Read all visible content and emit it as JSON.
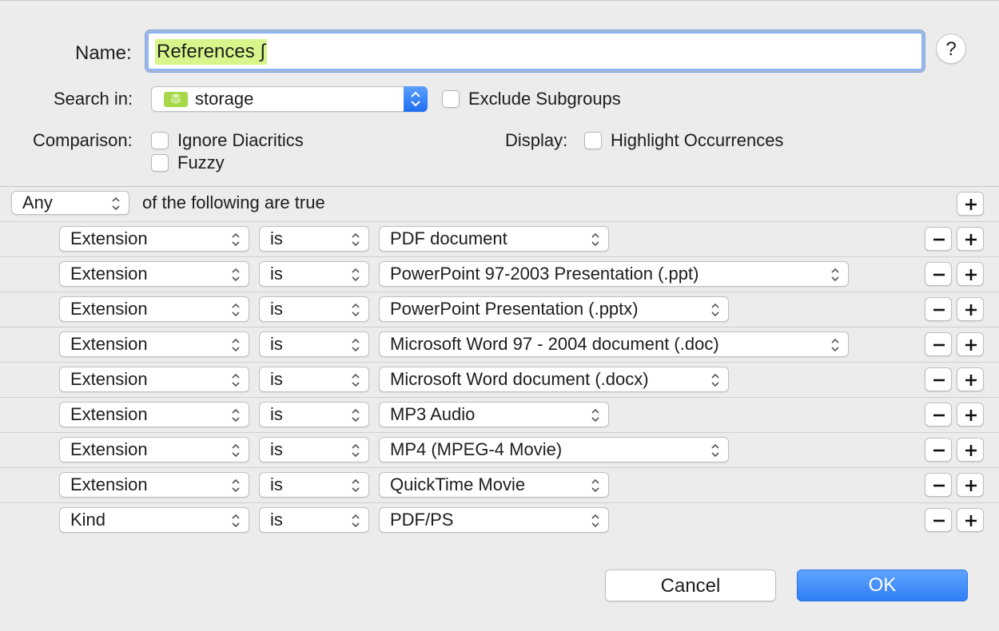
{
  "form": {
    "name_label": "Name:",
    "name_value": "References ∫",
    "help_label": "?",
    "search_in_label": "Search in:",
    "search_in_value": "storage",
    "exclude_subgroups_label": "Exclude Subgroups",
    "exclude_subgroups_checked": false,
    "comparison_label": "Comparison:",
    "ignore_diacritics_label": "Ignore Diacritics",
    "ignore_diacritics_checked": false,
    "fuzzy_label": "Fuzzy",
    "fuzzy_checked": false,
    "display_label": "Display:",
    "highlight_occurrences_label": "Highlight Occurrences",
    "highlight_occurrences_checked": false
  },
  "match": {
    "mode": "Any",
    "suffix": "of the following are true"
  },
  "criteria": [
    {
      "field": "Extension",
      "operator": "is",
      "value": "PDF document"
    },
    {
      "field": "Extension",
      "operator": "is",
      "value": "PowerPoint 97-2003 Presentation (.ppt)"
    },
    {
      "field": "Extension",
      "operator": "is",
      "value": "PowerPoint Presentation (.pptx)"
    },
    {
      "field": "Extension",
      "operator": "is",
      "value": "Microsoft Word 97 - 2004 document (.doc)"
    },
    {
      "field": "Extension",
      "operator": "is",
      "value": "Microsoft Word document (.docx)"
    },
    {
      "field": "Extension",
      "operator": "is",
      "value": "MP3 Audio"
    },
    {
      "field": "Extension",
      "operator": "is",
      "value": "MP4 (MPEG-4 Movie)"
    },
    {
      "field": "Extension",
      "operator": "is",
      "value": "QuickTime Movie"
    },
    {
      "field": "Kind",
      "operator": "is",
      "value": "PDF/PS"
    }
  ],
  "buttons": {
    "cancel": "Cancel",
    "ok": "OK"
  },
  "icons": {
    "storage": "group-folder-icon",
    "arrows": "up-down-chevron-icon",
    "add": "plus-icon",
    "remove": "minus-icon"
  },
  "colors": {
    "accent": "#2f7ef5",
    "name_highlight": "#d7f58a",
    "group_icon": "#a6d84a"
  }
}
